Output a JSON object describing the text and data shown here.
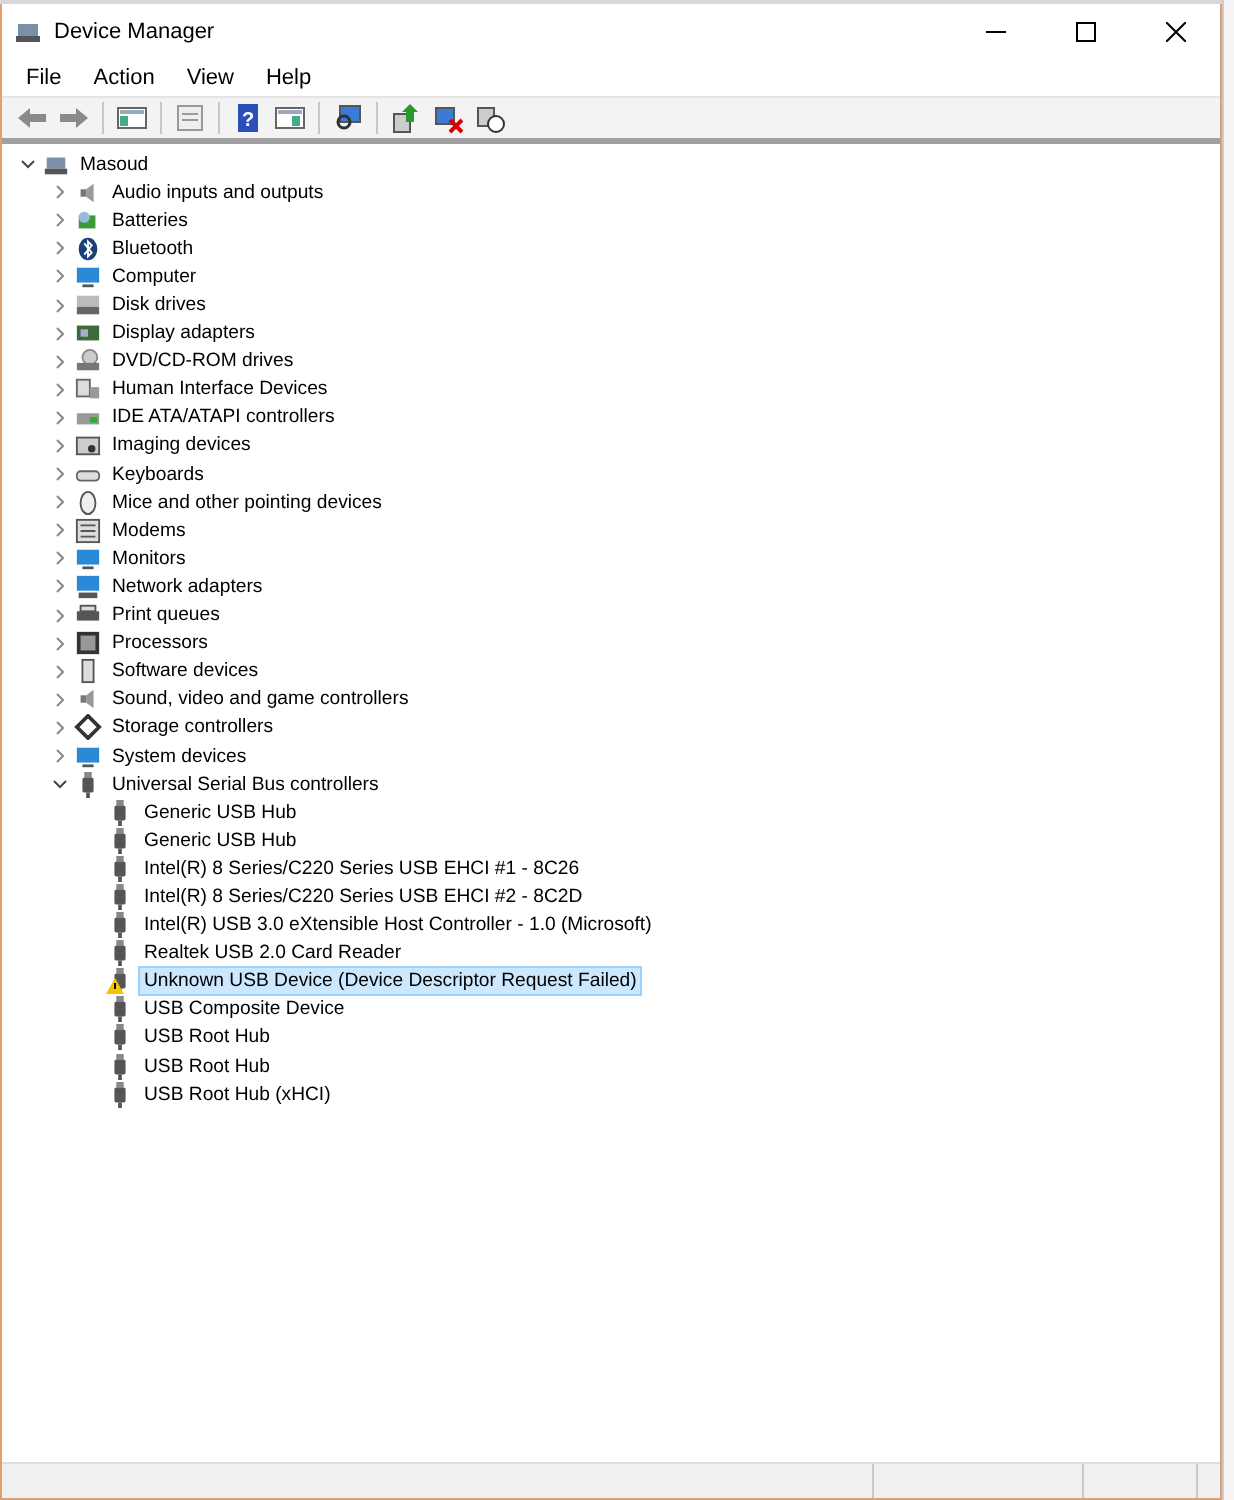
{
  "window": {
    "title": "Device Manager"
  },
  "menu": [
    "File",
    "Action",
    "View",
    "Help"
  ],
  "toolbar": {
    "help_glyph": "?"
  },
  "tree": {
    "label": "Masoud",
    "kind": "root",
    "expanded": true,
    "selected": false,
    "children": [
      {
        "label": "Audio inputs and outputs",
        "kind": "speaker",
        "expanded": false,
        "selected": false
      },
      {
        "label": "Batteries",
        "kind": "battery",
        "expanded": false,
        "selected": false
      },
      {
        "label": "Bluetooth",
        "kind": "bluetooth",
        "expanded": false,
        "selected": false
      },
      {
        "label": "Computer",
        "kind": "monitor",
        "expanded": false,
        "selected": false
      },
      {
        "label": "Disk drives",
        "kind": "disk",
        "expanded": false,
        "selected": false
      },
      {
        "label": "Display adapters",
        "kind": "card",
        "expanded": false,
        "selected": false
      },
      {
        "label": "DVD/CD-ROM drives",
        "kind": "disc",
        "expanded": false,
        "selected": false
      },
      {
        "label": "Human Interface Devices",
        "kind": "hid",
        "expanded": false,
        "selected": false
      },
      {
        "label": "IDE ATA/ATAPI controllers",
        "kind": "ide",
        "expanded": false,
        "selected": false
      },
      {
        "label": "Imaging devices",
        "kind": "camera",
        "expanded": false,
        "selected": false
      },
      {
        "label": "Keyboards",
        "kind": "keyboard",
        "expanded": false,
        "selected": false
      },
      {
        "label": "Mice and other pointing devices",
        "kind": "mouse",
        "expanded": false,
        "selected": false
      },
      {
        "label": "Modems",
        "kind": "modem",
        "expanded": false,
        "selected": false
      },
      {
        "label": "Monitors",
        "kind": "monitor",
        "expanded": false,
        "selected": false
      },
      {
        "label": "Network adapters",
        "kind": "network",
        "expanded": false,
        "selected": false
      },
      {
        "label": "Print queues",
        "kind": "printer",
        "expanded": false,
        "selected": false
      },
      {
        "label": "Processors",
        "kind": "chip",
        "expanded": false,
        "selected": false
      },
      {
        "label": "Software devices",
        "kind": "software",
        "expanded": false,
        "selected": false
      },
      {
        "label": "Sound, video and game controllers",
        "kind": "speaker",
        "expanded": false,
        "selected": false
      },
      {
        "label": "Storage controllers",
        "kind": "storage",
        "expanded": false,
        "selected": false
      },
      {
        "label": "System devices",
        "kind": "monitor",
        "expanded": false,
        "selected": false
      },
      {
        "label": "Universal Serial Bus controllers",
        "kind": "usb",
        "expanded": true,
        "selected": false,
        "children": [
          {
            "label": "Generic USB Hub",
            "kind": "usb",
            "selected": false,
            "warning": false
          },
          {
            "label": "Generic USB Hub",
            "kind": "usb",
            "selected": false,
            "warning": false
          },
          {
            "label": "Intel(R) 8 Series/C220 Series USB EHCI #1 - 8C26",
            "kind": "usb",
            "selected": false,
            "warning": false
          },
          {
            "label": "Intel(R) 8 Series/C220 Series USB EHCI #2 - 8C2D",
            "kind": "usb",
            "selected": false,
            "warning": false
          },
          {
            "label": "Intel(R) USB 3.0 eXtensible Host Controller - 1.0 (Microsoft)",
            "kind": "usb",
            "selected": false,
            "warning": false
          },
          {
            "label": "Realtek USB 2.0 Card Reader",
            "kind": "usb",
            "selected": false,
            "warning": false
          },
          {
            "label": "Unknown USB Device (Device Descriptor Request Failed)",
            "kind": "usb",
            "selected": true,
            "warning": true
          },
          {
            "label": "USB Composite Device",
            "kind": "usb",
            "selected": false,
            "warning": false
          },
          {
            "label": "USB Root Hub",
            "kind": "usb",
            "selected": false,
            "warning": false
          },
          {
            "label": "USB Root Hub",
            "kind": "usb",
            "selected": false,
            "warning": false
          },
          {
            "label": "USB Root Hub (xHCI)",
            "kind": "usb",
            "selected": false,
            "warning": false
          }
        ]
      }
    ]
  }
}
